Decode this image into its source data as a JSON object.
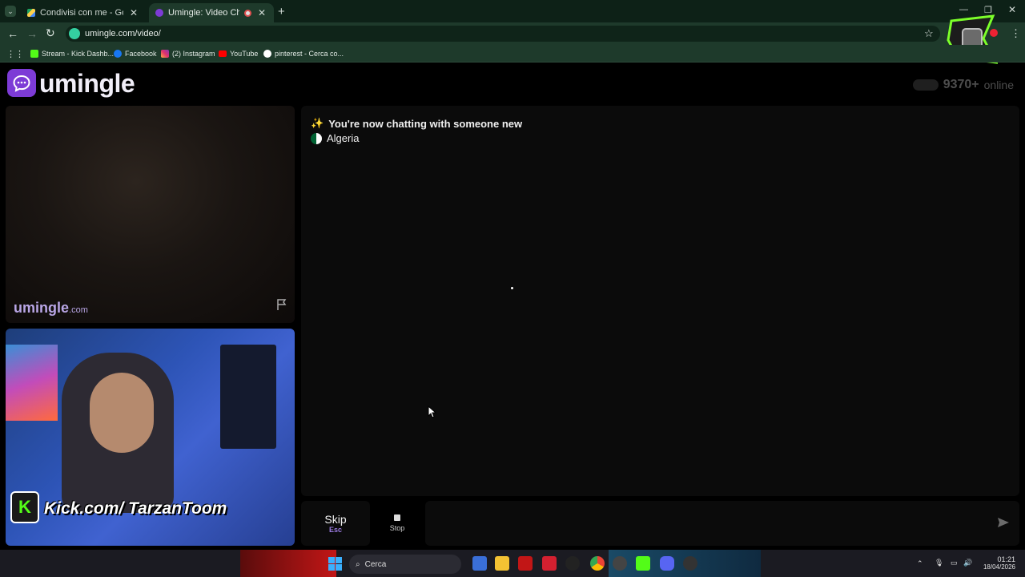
{
  "browser": {
    "tabs": [
      {
        "title": "Condivisi con me - Google Driv",
        "active": false
      },
      {
        "title": "Umingle: Video Chat with S",
        "active": true
      }
    ],
    "url": "umingle.com/video/",
    "bookmarks": [
      {
        "label": "Stream - Kick Dashb...",
        "icon": "kick-icon",
        "color": "#53fc18"
      },
      {
        "label": "Facebook",
        "icon": "facebook-icon",
        "color": "#1877f2"
      },
      {
        "label": "(2) Instagram",
        "icon": "instagram-icon",
        "color": "#e1306c"
      },
      {
        "label": "YouTube",
        "icon": "youtube-icon",
        "color": "#ff0000"
      },
      {
        "label": "pinterest - Cerca co...",
        "icon": "google-icon",
        "color": "#ffffff"
      }
    ]
  },
  "site": {
    "logo": "umingle",
    "online_count": "9370+",
    "online_label": "online",
    "accent": "#7d3bd6"
  },
  "remote_video": {
    "watermark": "umingle",
    "watermark_suffix": ".com"
  },
  "local_video": {
    "overlay_text": "Kick.com/ TarzanToom",
    "badge": "K"
  },
  "chat": {
    "status_icon": "✨",
    "status_message": "You're now chatting with someone new",
    "country": "Algeria"
  },
  "controls": {
    "skip_label": "Skip",
    "skip_hint": "Esc",
    "stop_label": "Stop",
    "message_placeholder": ""
  },
  "taskbar": {
    "search_label": "Cerca",
    "time": "01:21",
    "date": "18/04/2026"
  }
}
